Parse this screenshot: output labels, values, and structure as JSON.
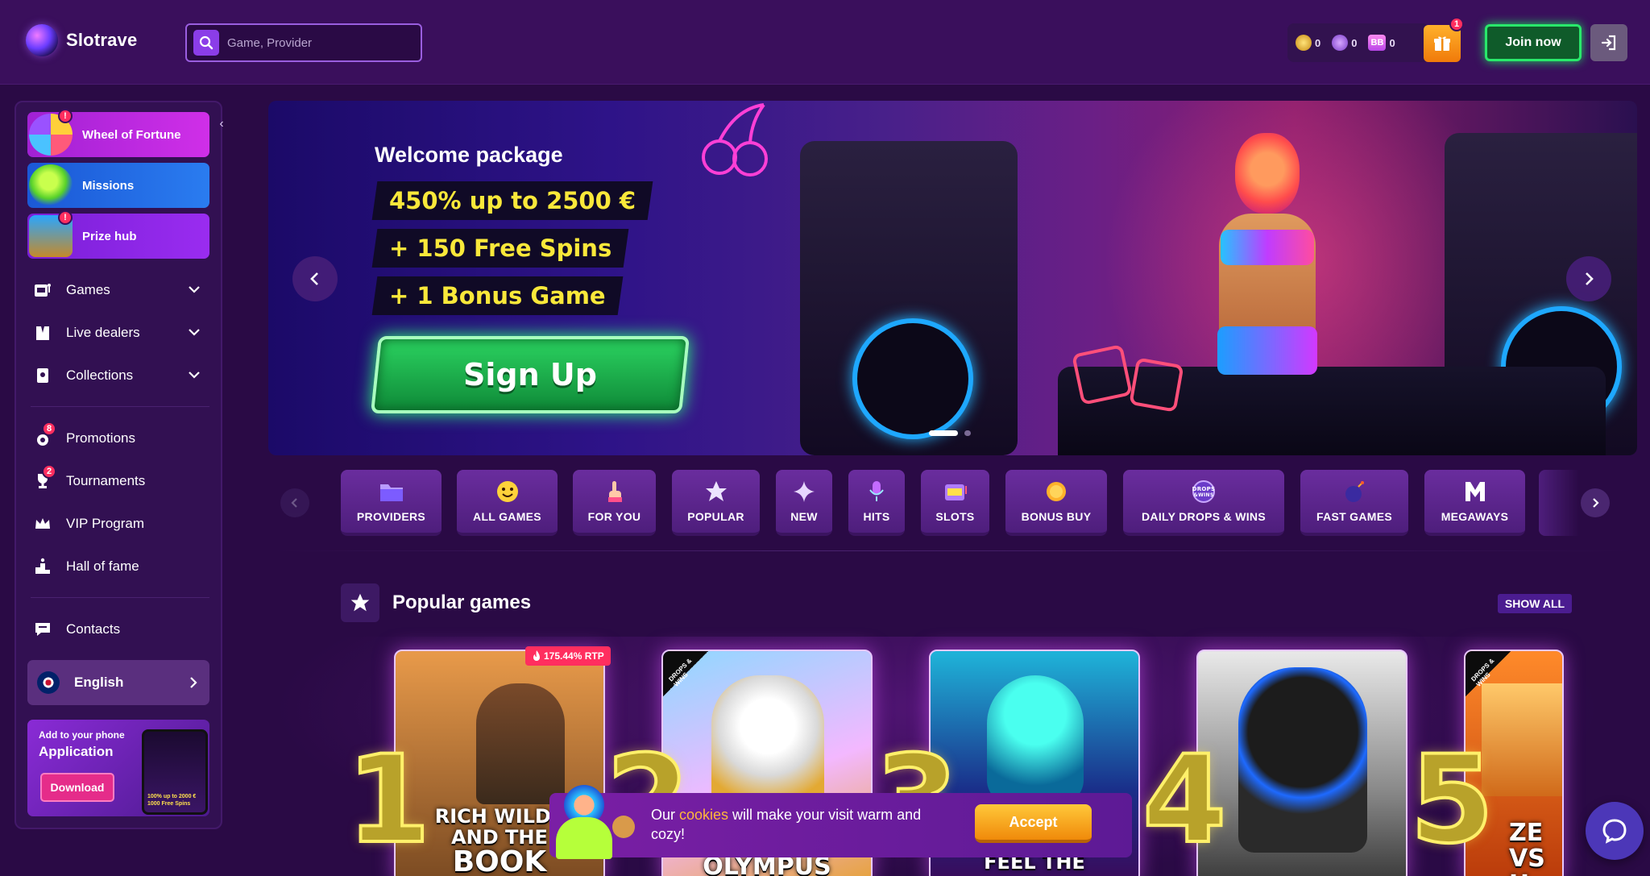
{
  "header": {
    "logo_text": "Slotrave",
    "search_placeholder": "Game, Provider",
    "balances": [
      {
        "icon": "gold-coin-icon",
        "value": "0"
      },
      {
        "icon": "free-spins-coin-icon",
        "value": "0"
      },
      {
        "icon": "bonus-buy-icon",
        "label": "BB",
        "value": "0"
      }
    ],
    "gift_badge": "1",
    "join_label": "Join now"
  },
  "sidebar": {
    "promo_cards": [
      {
        "label": "Wheel of Fortune",
        "badge": "!",
        "color": "#c22be0"
      },
      {
        "label": "Missions",
        "badge": "",
        "color": "#1f6ae6"
      },
      {
        "label": "Prize hub",
        "badge": "!",
        "color": "#8f22e6"
      }
    ],
    "menu": [
      {
        "label": "Games",
        "icon": "slot-machine-icon"
      },
      {
        "label": "Live dealers",
        "icon": "dealer-icon"
      },
      {
        "label": "Collections",
        "icon": "collection-icon"
      }
    ],
    "links": [
      {
        "label": "Promotions",
        "badge": "8",
        "icon": "medal-icon"
      },
      {
        "label": "Tournaments",
        "badge": "2",
        "icon": "trophy-icon"
      },
      {
        "label": "VIP Program",
        "badge": "",
        "icon": "crown-icon"
      },
      {
        "label": "Hall of fame",
        "badge": "",
        "icon": "podium-icon"
      }
    ],
    "contacts_label": "Contacts",
    "language_label": "English",
    "app": {
      "small": "Add to your phone",
      "big": "Application",
      "download": "Download",
      "phone_text_1": "100% up to 2000 €",
      "phone_text_2": "1000 Free Spins"
    }
  },
  "banner": {
    "title": "Welcome package",
    "lines": [
      "450% up to 2500 €",
      "+ 150 Free Spins",
      "+ 1 Bonus Game"
    ],
    "cta": "Sign Up",
    "slides": 2,
    "active_slide": 1
  },
  "categories": [
    {
      "label": "PROVIDERS",
      "icon": "folder-icon"
    },
    {
      "label": "ALL GAMES",
      "icon": "smiley-icon"
    },
    {
      "label": "FOR YOU",
      "icon": "pointing-hand-icon"
    },
    {
      "label": "POPULAR",
      "icon": "star-icon"
    },
    {
      "label": "NEW",
      "icon": "sparkle-icon"
    },
    {
      "label": "HITS",
      "icon": "microphone-icon"
    },
    {
      "label": "SLOTS",
      "icon": "slot-machine-icon"
    },
    {
      "label": "BONUS BUY",
      "icon": "coin-icon"
    },
    {
      "label": "DAILY DROPS & WINS",
      "icon": "drops-wins-icon"
    },
    {
      "label": "FAST GAMES",
      "icon": "bomb-icon"
    },
    {
      "label": "MEGAWAYS",
      "icon": "m-letter-icon"
    }
  ],
  "popular": {
    "title": "Popular games",
    "show_all": "SHOW ALL",
    "games": [
      {
        "rank": "1",
        "title_lines": [
          "RICH WILDE",
          "AND THE",
          "BOOK"
        ],
        "rtp": "175.44% RTP",
        "drops": false
      },
      {
        "rank": "2",
        "title_lines": [
          "OLYMPUS"
        ],
        "rtp": "",
        "drops": true
      },
      {
        "rank": "3",
        "title_lines": [
          "FEEL THE"
        ],
        "rtp": "",
        "drops": false
      },
      {
        "rank": "4",
        "title_lines": [
          ""
        ],
        "rtp": "",
        "drops": false
      },
      {
        "rank": "5",
        "title_lines": [
          "ZE",
          "VS H"
        ],
        "rtp": "",
        "drops": true
      }
    ],
    "drops_tag": "DROPS & WINS"
  },
  "cookie": {
    "text_before": "Our ",
    "link": "cookies",
    "text_after": " will make your visit warm and cozy!",
    "accept": "Accept"
  }
}
